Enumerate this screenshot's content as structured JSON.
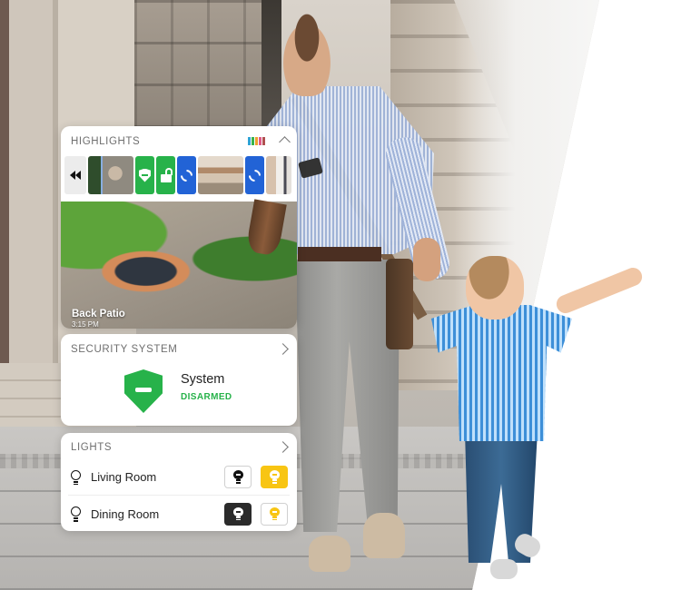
{
  "highlights": {
    "title": "HIGHLIGHTS",
    "legend_colors": [
      "#2ea3d6",
      "#37b34a",
      "#f0a030",
      "#e05a8a",
      "#b05050"
    ],
    "strip": [
      {
        "type": "rewind",
        "icon": "rewind-icon"
      },
      {
        "type": "photo",
        "label": "patio-clip-thumbnail"
      },
      {
        "type": "event",
        "icon": "shield-disarmed-icon",
        "color": "#27b24a"
      },
      {
        "type": "event",
        "icon": "unlock-icon",
        "color": "#27b24a"
      },
      {
        "type": "event",
        "icon": "link-icon",
        "color": "#2263d6"
      },
      {
        "type": "photo",
        "label": "room-clip-thumbnail"
      },
      {
        "type": "event",
        "icon": "link-icon",
        "color": "#2263d6"
      },
      {
        "type": "photo",
        "label": "hallway-clip-thumbnail"
      }
    ],
    "preview": {
      "camera": "Back Patio",
      "time": "3:15 PM"
    }
  },
  "security": {
    "title": "SECURITY SYSTEM",
    "label": "System",
    "status": "DISARMED",
    "status_color": "#27b24a"
  },
  "lights": {
    "title": "LIGHTS",
    "rooms": [
      {
        "name": "Living Room",
        "state": "on"
      },
      {
        "name": "Dining Room",
        "state": "off"
      }
    ],
    "accent_on": "#f8c513"
  }
}
